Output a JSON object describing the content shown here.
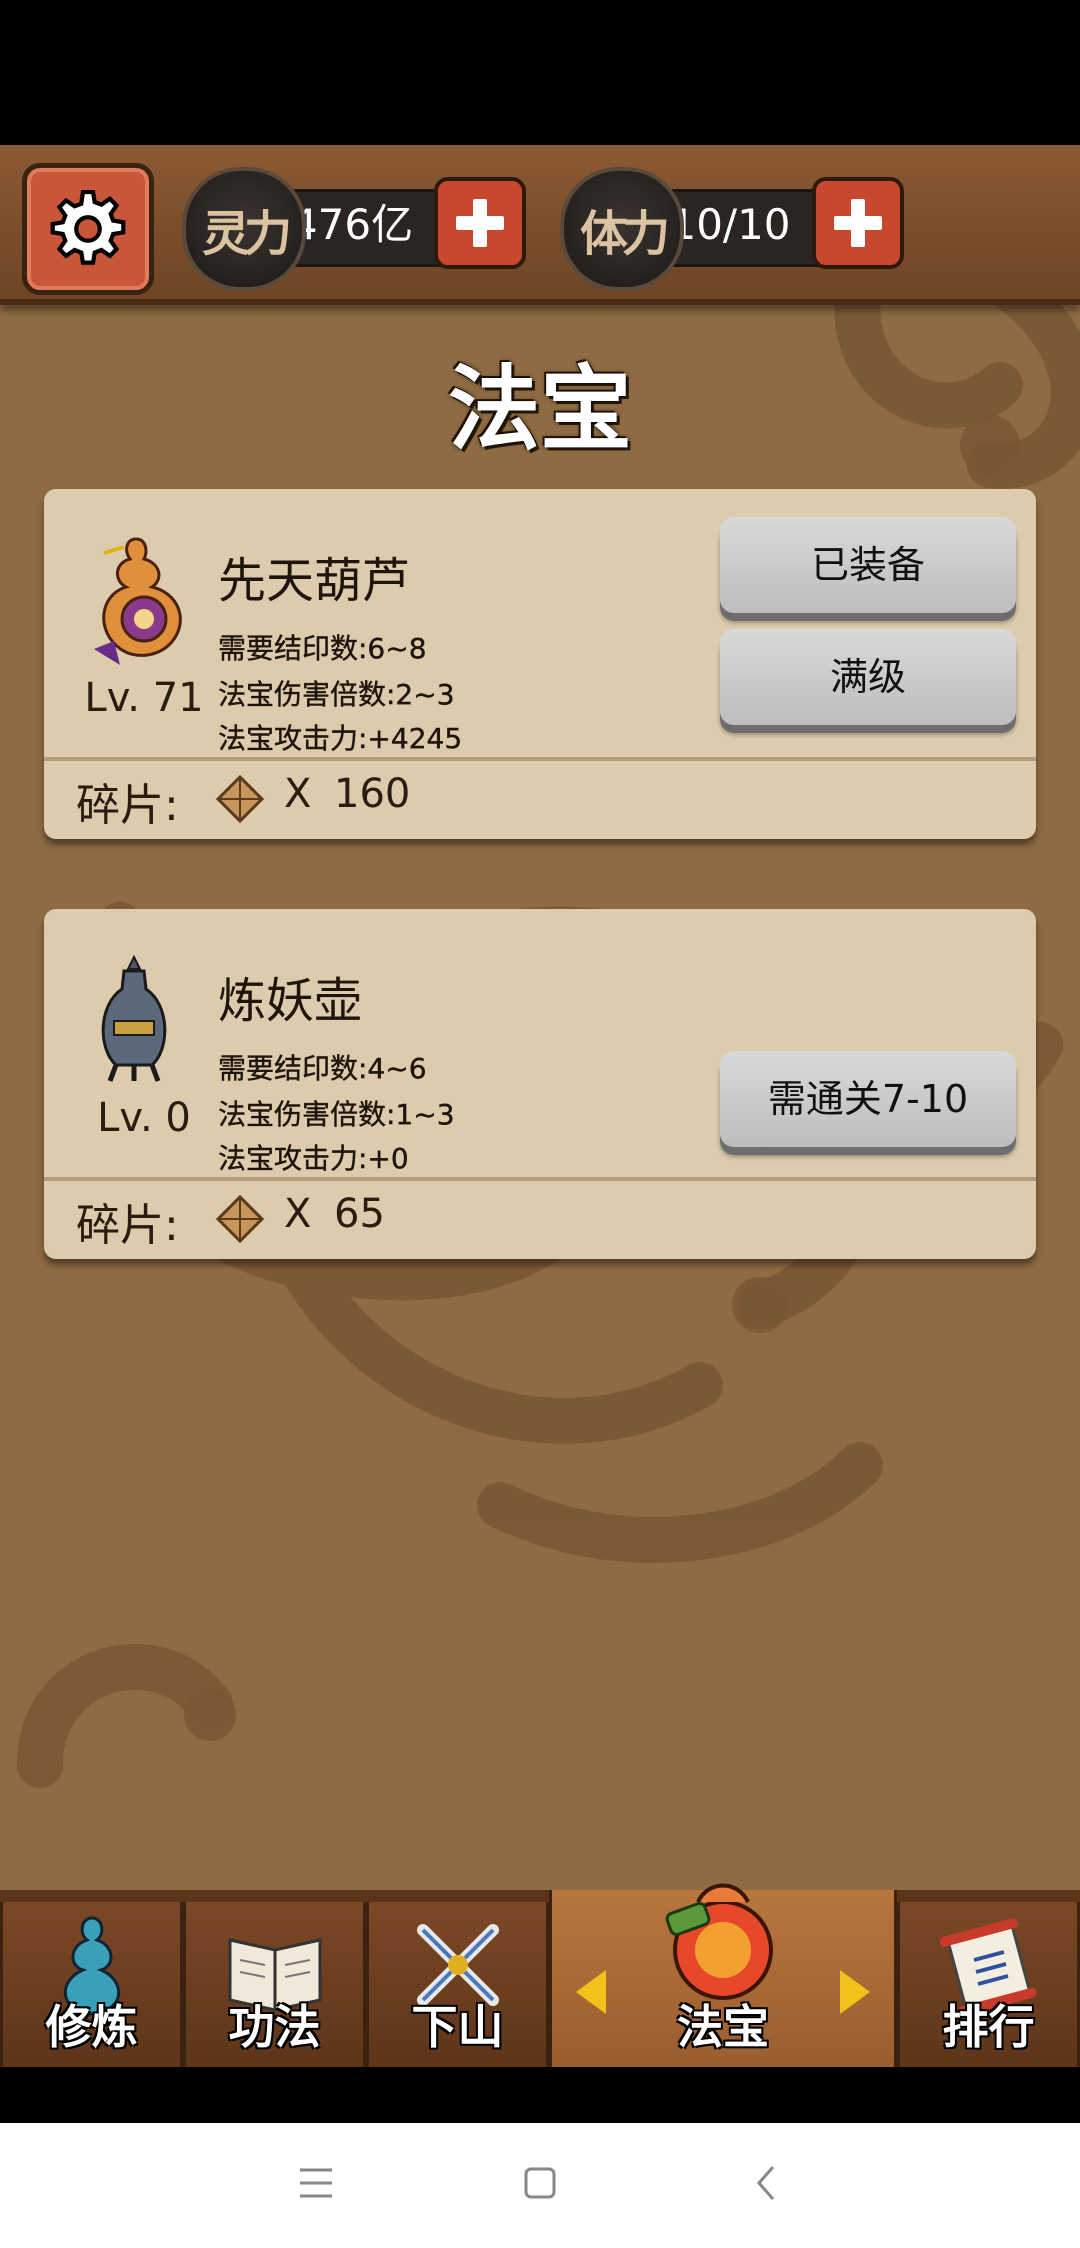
{
  "header": {
    "spirit": {
      "icon_text": "灵力",
      "value": "476亿"
    },
    "stamina": {
      "icon_text": "体力",
      "value": "10/10"
    }
  },
  "page_title": "法宝",
  "treasures": [
    {
      "name": "先天葫芦",
      "level": "Lv. 71",
      "stats": [
        "需要结印数:6~8",
        "法宝伤害倍数:2~3",
        "法宝攻击力:+4245"
      ],
      "buttons": [
        "已装备",
        "满级"
      ],
      "shard_label": "碎片:",
      "shard_x": "X",
      "shard_count": "160"
    },
    {
      "name": "炼妖壶",
      "level": "Lv. 0",
      "stats": [
        "需要结印数:4~6",
        "法宝伤害倍数:1~3",
        "法宝攻击力:+0"
      ],
      "buttons": [
        "需通关7-10"
      ],
      "shard_label": "碎片:",
      "shard_x": "X",
      "shard_count": "65"
    }
  ],
  "bottom_nav": [
    "修炼",
    "功法",
    "下山",
    "法宝",
    "排行"
  ],
  "active_tab": "法宝",
  "colors": {
    "accent_red": "#c7482c",
    "card_bg": "#dccbac",
    "arrow_yellow": "#f2c21a"
  }
}
